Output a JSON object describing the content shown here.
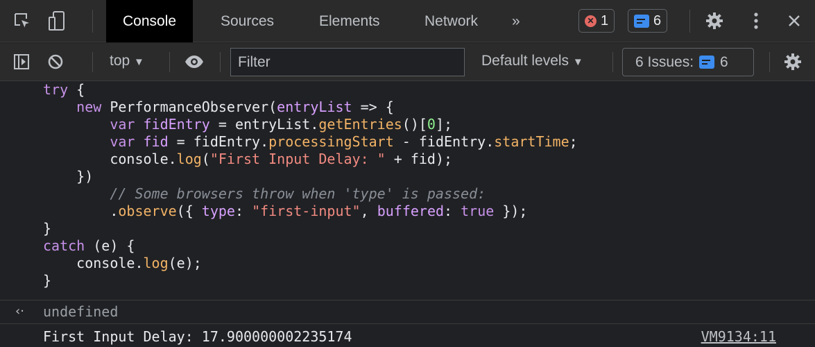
{
  "tabs": {
    "console": "Console",
    "sources": "Sources",
    "elements": "Elements",
    "network": "Network",
    "more": "»"
  },
  "badges": {
    "errors": "1",
    "messages": "6"
  },
  "toolbar": {
    "context": "top",
    "filter_placeholder": "Filter",
    "levels": "Default levels",
    "issues_label": "6 Issues:",
    "issues_count": "6"
  },
  "code": [
    "try {",
    "    new PerformanceObserver(entryList => {",
    "        var fidEntry = entryList.getEntries()[0];",
    "        var fid = fidEntry.processingStart - fidEntry.startTime;",
    "        console.log(\"First Input Delay: \" + fid);",
    "    })",
    "        // Some browsers throw when 'type' is passed:",
    "        .observe({ type: \"first-input\", buffered: true });",
    "}",
    "catch (e) {",
    "    console.log(e);",
    "}"
  ],
  "result": {
    "arrow": "‹·",
    "value": "undefined"
  },
  "log": {
    "message": "First Input Delay: 17.900000002235174",
    "source": "VM9134:11"
  },
  "colors": {
    "error": "#e46962",
    "info": "#3c8cf0",
    "active_tab_bg": "#000000"
  }
}
